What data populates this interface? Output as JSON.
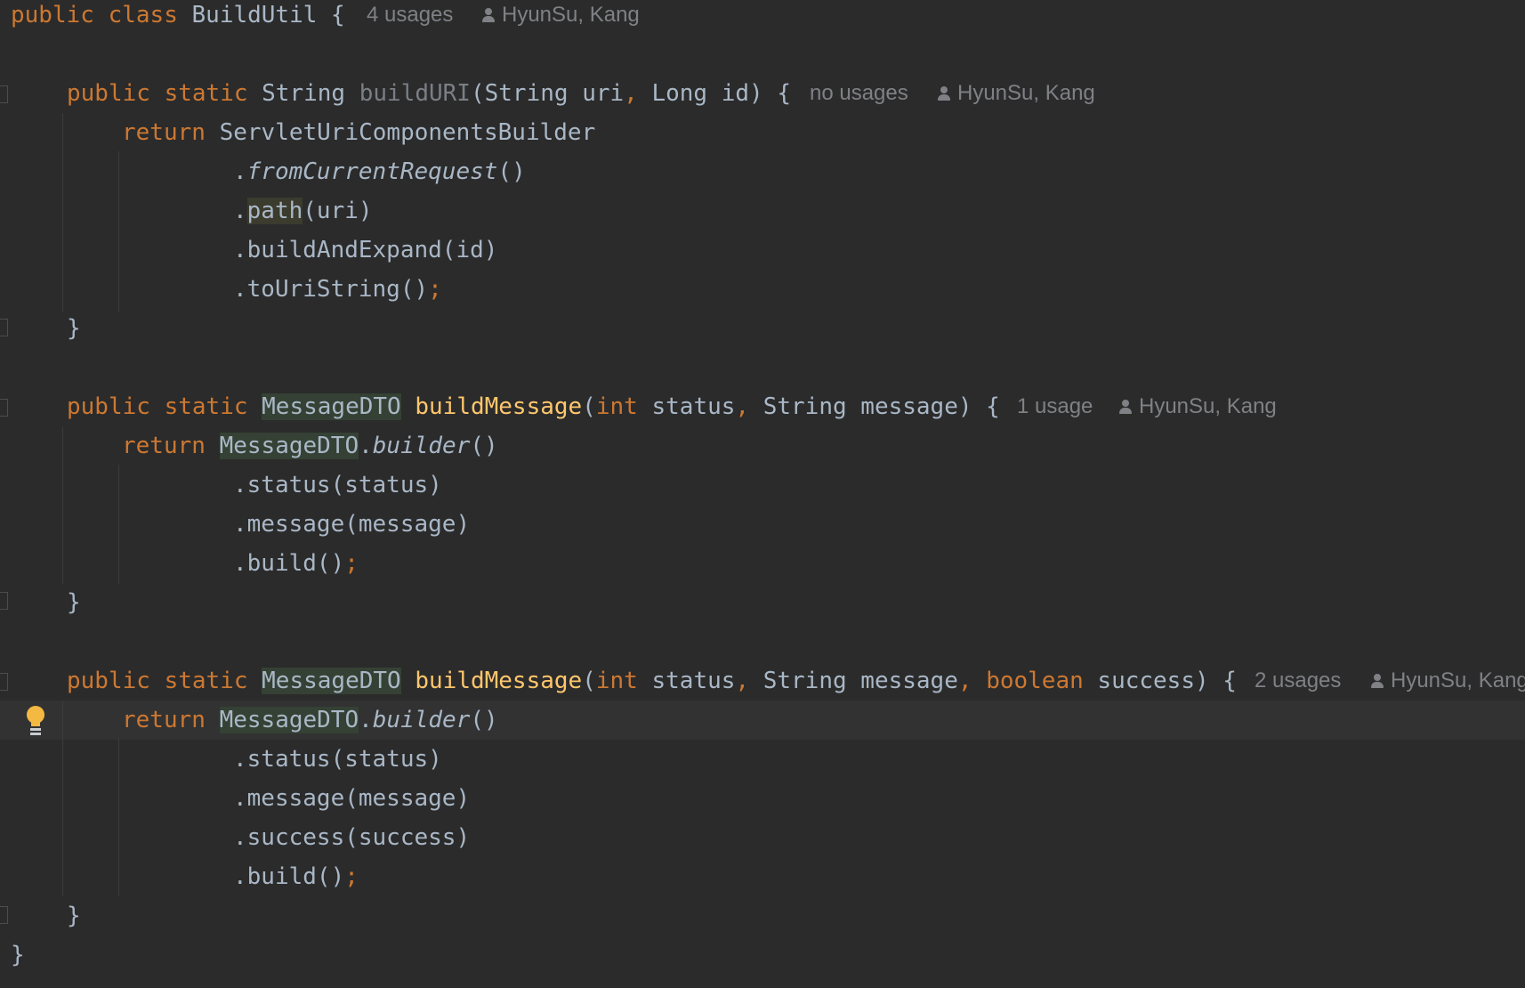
{
  "editor": {
    "line1": {
      "t1": "public",
      "t2": "class",
      "t3": "BuildUtil {",
      "usages": "4 usages",
      "author": "HyunSu, Kang"
    },
    "line3": {
      "t1": "public",
      "t2": "static",
      "t3": "String",
      "t4": "buildURI",
      "t5": "(String uri",
      "t6": ",",
      "t7": " Long id) {",
      "usages": "no usages",
      "author": "HyunSu, Kang"
    },
    "line4": {
      "t1": "return",
      "t2": "ServletUriComponentsBuilder"
    },
    "line5": {
      "t1": ".",
      "t2": "fromCurrentRequest",
      "t3": "()"
    },
    "line6": {
      "t1": ".",
      "t2": "path",
      "t3": "(uri)"
    },
    "line7": {
      "t1": ".buildAndExpand(id)"
    },
    "line8": {
      "t1": ".toUriString()",
      "t2": ";"
    },
    "line9": {
      "t1": "}"
    },
    "line11": {
      "t1": "public",
      "t2": "static",
      "t3": "MessageDTO",
      "t4": "buildMessage",
      "t5": "(",
      "t6": "int",
      "t7": " status",
      "t8": ",",
      "t9": " String message) {",
      "usages": "1 usage",
      "author": "HyunSu, Kang"
    },
    "line12": {
      "t1": "return",
      "t2": "MessageDTO",
      "t3": ".",
      "t4": "builder",
      "t5": "()"
    },
    "line13": {
      "t1": ".status(status)"
    },
    "line14": {
      "t1": ".message(message)"
    },
    "line15": {
      "t1": ".build()",
      "t2": ";"
    },
    "line16": {
      "t1": "}"
    },
    "line18": {
      "t1": "public",
      "t2": "static",
      "t3": "MessageDTO",
      "t4": "buildMessage",
      "t5": "(",
      "t6": "int",
      "t7": " status",
      "t8": ",",
      "t9": " String message",
      "t10": ",",
      "t11": "boolean",
      "t12": " success) {",
      "usages": "2 usages",
      "author": "HyunSu, Kang"
    },
    "line19": {
      "t1": "return",
      "t2": "MessageDTO",
      "t3": ".",
      "t4": "builder",
      "t5": "()"
    },
    "line20": {
      "t1": ".status(status)"
    },
    "line21": {
      "t1": ".message(message)"
    },
    "line22": {
      "t1": ".success(success)"
    },
    "line23": {
      "t1": ".build()",
      "t2": ";"
    },
    "line24": {
      "t1": "}"
    },
    "line25": {
      "t1": "}"
    }
  },
  "icons": {
    "author": "person-icon",
    "intention": "lightbulb-icon",
    "fold": "fold-marker-icon"
  },
  "colors": {
    "background": "#2b2b2b",
    "keyword": "#cc7832",
    "function": "#ffc66d",
    "text": "#a9b7c6",
    "hint": "#7f8185",
    "bulb": "#f4b942"
  }
}
